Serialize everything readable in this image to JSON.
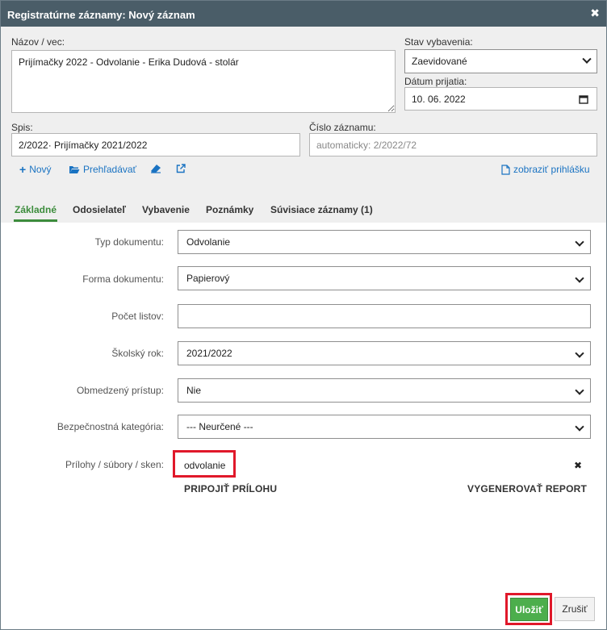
{
  "window": {
    "title": "Registratúrne záznamy: Nový záznam",
    "close_glyph": "✖"
  },
  "header_form": {
    "name_label": "Názov / vec:",
    "name_value": "Prijímačky 2022 - Odvolanie - Erika Dudová - stolár",
    "status_label": "Stav vybavenia:",
    "status_value": "Zaevidované",
    "date_label": "Dátum prijatia:",
    "date_value": "10. 06. 2022",
    "file_label": "Spis:",
    "file_value": "2/2022· Prijímačky 2021/2022",
    "number_label": "Číslo záznamu:",
    "number_placeholder": "automaticky: 2/2022/72"
  },
  "toolbar": {
    "new_label": "Nový",
    "browse_label": "Prehľadávať",
    "show_application_label": "zobraziť prihlášku"
  },
  "tabs": [
    {
      "label": "Základné",
      "active": true
    },
    {
      "label": "Odosielateľ",
      "active": false
    },
    {
      "label": "Vybavenie",
      "active": false
    },
    {
      "label": "Poznámky",
      "active": false
    },
    {
      "label": "Súvisiace záznamy (1)",
      "active": false
    }
  ],
  "basic_form": {
    "doc_type_label": "Typ dokumentu:",
    "doc_type_value": "Odvolanie",
    "doc_form_label": "Forma dokumentu:",
    "doc_form_value": "Papierový",
    "sheets_label": "Počet listov:",
    "sheets_value": "",
    "school_year_label": "Školský rok:",
    "school_year_value": "2021/2022",
    "restricted_label": "Obmedzený prístup:",
    "restricted_value": "Nie",
    "security_label": "Bezpečnostná kategória:",
    "security_value": "--- Neurčené ---",
    "attachments_label": "Prílohy / súbory / sken:",
    "attachment_name": "odvolanie",
    "attach_label": "PRIPOJIŤ PRÍLOHU",
    "generate_label": "VYGENEROVAŤ REPORT",
    "remove_glyph": "✖"
  },
  "footer": {
    "save_label": "Uložiť",
    "cancel_label": "Zrušiť"
  },
  "colors": {
    "titlebar": "#4a5d68",
    "link": "#1a73c2",
    "active_tab": "#3c8c3c",
    "save_button": "#4cae4c",
    "highlight": "#e0182a"
  }
}
